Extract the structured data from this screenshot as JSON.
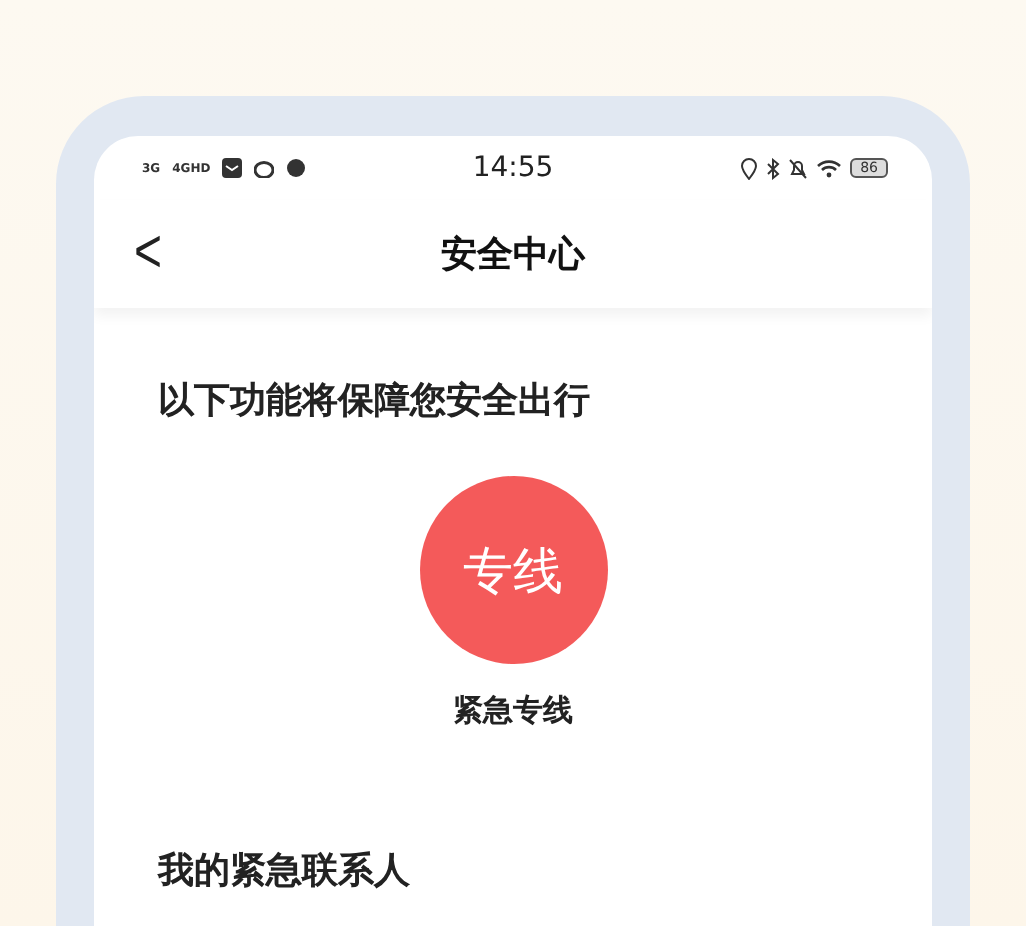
{
  "status_bar": {
    "network_labels": [
      "3G",
      "4GHD"
    ],
    "time": "14:55",
    "battery": "86"
  },
  "header": {
    "back": "<",
    "title": "安全中心"
  },
  "features": {
    "title": "以下功能将保障您安全出行",
    "items": [
      {
        "icon_text": "专线",
        "label": "紧急专线"
      }
    ]
  },
  "contacts": {
    "title": "我的紧急联系人"
  }
}
